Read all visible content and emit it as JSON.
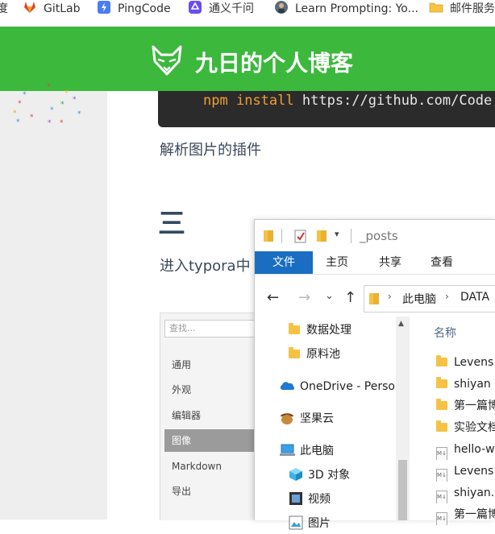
{
  "bookmarks": [
    {
      "label": "度",
      "icon": "none"
    },
    {
      "label": "GitLab",
      "icon": "gitlab-icon"
    },
    {
      "label": "PingCode",
      "icon": "pingcode-icon"
    },
    {
      "label": "通义千问",
      "icon": "tongyi-icon"
    },
    {
      "label": "Learn Prompting: Yo...",
      "icon": "learn-prompting-icon"
    },
    {
      "label": "邮件服务",
      "icon": "folder-icon"
    }
  ],
  "blog": {
    "title": "九日的个人博客",
    "code": {
      "cmd": "npm",
      "sub": "install",
      "url": "https://github.com/Code"
    },
    "paragraph1": "解析图片的插件",
    "heading": "三",
    "paragraph2": "进入typora中"
  },
  "typora_prefs": {
    "search_placeholder": "查找...",
    "items": [
      "通用",
      "外观",
      "编辑器",
      "图像",
      "Markdown",
      "导出"
    ],
    "selected": "图像"
  },
  "explorer": {
    "title": "_posts",
    "ribbon_tabs": [
      "文件",
      "主页",
      "共享",
      "查看"
    ],
    "breadcrumb": [
      "此电脑",
      "DATA"
    ],
    "nav_items": [
      {
        "label": "数据处理",
        "icon": "folder-icon"
      },
      {
        "label": "原料池",
        "icon": "folder-icon"
      },
      {
        "label": "OneDrive - Perso",
        "icon": "onedrive-icon"
      },
      {
        "label": "坚果云",
        "icon": "jianguoyun-icon"
      },
      {
        "label": "此电脑",
        "icon": "computer-icon"
      },
      {
        "label": "3D 对象",
        "icon": "3d-objects-icon"
      },
      {
        "label": "视频",
        "icon": "video-icon"
      },
      {
        "label": "图片",
        "icon": "pictures-icon"
      }
    ],
    "column_header": "名称",
    "files": [
      {
        "name": "Levens",
        "type": "folder"
      },
      {
        "name": "shiyan",
        "type": "folder"
      },
      {
        "name": "第一篇博",
        "type": "folder"
      },
      {
        "name": "实验文档",
        "type": "folder"
      },
      {
        "name": "hello-w",
        "type": "markdown"
      },
      {
        "name": "Levens",
        "type": "markdown"
      },
      {
        "name": "shiyan.",
        "type": "markdown"
      },
      {
        "name": "第一篇博",
        "type": "markdown"
      }
    ]
  },
  "colors": {
    "header_green": "#3cb83d",
    "file_tab_blue": "#1a6ec2",
    "code_bg": "#2b2b2b",
    "keyword_orange": "#f0a030"
  }
}
